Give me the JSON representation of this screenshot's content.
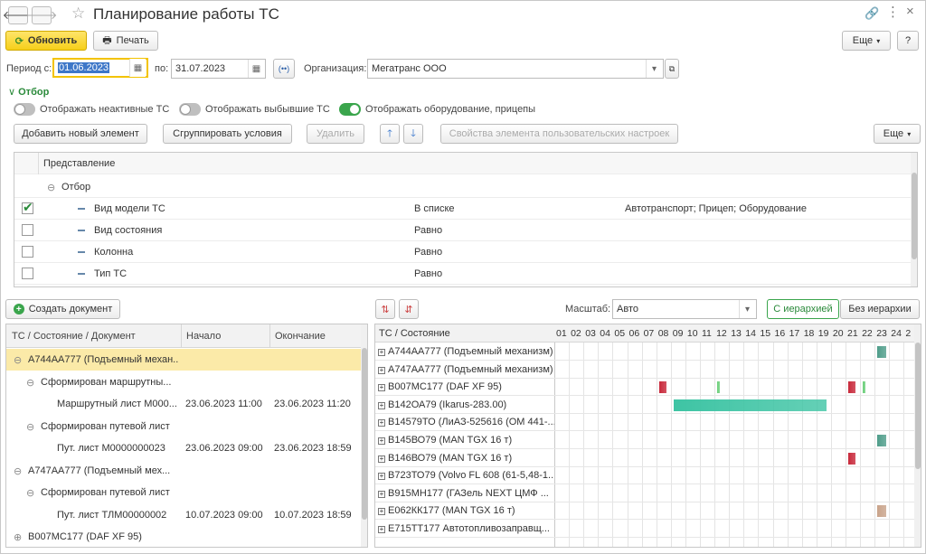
{
  "window": {
    "title": "Планирование работы ТС"
  },
  "toolbar": {
    "refresh": "Обновить",
    "print": "Печать",
    "more": "Еще",
    "help": "?"
  },
  "period": {
    "from_label": "Период с:",
    "from": "01.06.2023",
    "to_label": "по:",
    "to": "31.07.2023"
  },
  "org": {
    "label": "Организация:",
    "value": "Мегатранс ООО"
  },
  "filter": {
    "header": "Отбор",
    "toggles": [
      {
        "label": "Отображать неактивные ТС",
        "on": false
      },
      {
        "label": "Отображать выбывшие ТС",
        "on": false
      },
      {
        "label": "Отображать оборудование, прицепы",
        "on": true
      }
    ],
    "buttons": {
      "add": "Добавить новый элемент",
      "group": "Сгруппировать условия",
      "delete": "Удалить",
      "props": "Свойства элемента пользовательских настроек",
      "more": "Еще"
    },
    "table_header": "Представление",
    "root": "Отбор",
    "rows": [
      {
        "checked": true,
        "name": "Вид модели ТС",
        "cond": "В списке",
        "value": "Автотранспорт; Прицеп; Оборудование"
      },
      {
        "checked": false,
        "name": "Вид состояния",
        "cond": "Равно",
        "value": ""
      },
      {
        "checked": false,
        "name": "Колонна",
        "cond": "Равно",
        "value": ""
      },
      {
        "checked": false,
        "name": "Тип ТС",
        "cond": "Равно",
        "value": ""
      }
    ]
  },
  "left": {
    "create_doc": "Создать документ",
    "columns": [
      "ТС / Состояние / Документ",
      "Начало",
      "Окончание"
    ],
    "rows": [
      {
        "level": 0,
        "text": "А744АА777 (Подъемный механ...",
        "start": "",
        "end": "",
        "selected": true,
        "toggle": "⊖"
      },
      {
        "level": 1,
        "text": "Сформирован маршрутны...",
        "start": "",
        "end": "",
        "toggle": "⊖"
      },
      {
        "level": 2,
        "text": "Маршрутный лист М000...",
        "start": "23.06.2023 11:00",
        "end": "23.06.2023 11:20"
      },
      {
        "level": 1,
        "text": "Сформирован путевой лист",
        "start": "",
        "end": "",
        "toggle": "⊖"
      },
      {
        "level": 2,
        "text": "Пут. лист М0000000023",
        "start": "23.06.2023 09:00",
        "end": "23.06.2023 18:59"
      },
      {
        "level": 0,
        "text": "А747АА777 (Подъемный мех...",
        "start": "",
        "end": "",
        "toggle": "⊖"
      },
      {
        "level": 1,
        "text": "Сформирован путевой лист",
        "start": "",
        "end": "",
        "toggle": "⊖"
      },
      {
        "level": 2,
        "text": "Пут. лист ТЛМ00000002",
        "start": "10.07.2023 09:00",
        "end": "10.07.2023 18:59"
      },
      {
        "level": 0,
        "text": "В007МС177 (DAF XF 95)",
        "start": "",
        "end": "",
        "toggle": "⊕"
      }
    ]
  },
  "right": {
    "scale_label": "Масштаб:",
    "scale_value": "Авто",
    "with_hier": "С иерархией",
    "without_hier": "Без иерархии",
    "col_header": "ТС / Состояние",
    "days": [
      "01",
      "02",
      "03",
      "04",
      "05",
      "06",
      "07",
      "08",
      "09",
      "10",
      "11",
      "12",
      "13",
      "14",
      "15",
      "16",
      "17",
      "18",
      "19",
      "20",
      "21",
      "22",
      "23",
      "24",
      "2"
    ],
    "rows": [
      {
        "name": "А744АА777 (Подъемный механизм)",
        "bars": [
          {
            "day": 23,
            "len": 0.6,
            "color": "#4f9d8a"
          }
        ]
      },
      {
        "name": "А747АА777 (Подъемный механизм)",
        "bars": []
      },
      {
        "name": "В007МС177 (DAF XF 95)",
        "bars": [
          {
            "day": 8,
            "len": 0.5,
            "color": "#c8283a"
          },
          {
            "day": 12,
            "len": 0.15,
            "color": "#6bcf7a"
          },
          {
            "day": 21,
            "len": 0.5,
            "color": "#c8283a"
          },
          {
            "day": 22,
            "len": 0.15,
            "color": "#6bcf7a"
          }
        ]
      },
      {
        "name": "В142ОА79 (Ikarus-283.00)",
        "bars": [
          {
            "day": 9,
            "len": 10.5,
            "color": "#3ec4a4"
          }
        ]
      },
      {
        "name": "В14579ТО (ЛиАЗ-525616 (ОМ 441-...",
        "bars": []
      },
      {
        "name": "В145ВО79 (MAN TGX 16 т)",
        "bars": [
          {
            "day": 23,
            "len": 0.6,
            "color": "#4f9d8a"
          }
        ]
      },
      {
        "name": "В146ВО79 (MAN TGX 16 т)",
        "bars": [
          {
            "day": 21,
            "len": 0.5,
            "color": "#c8283a"
          }
        ]
      },
      {
        "name": "В723ТО79 (Volvo FL 608 (61-5,48-1...",
        "bars": []
      },
      {
        "name": "В915МН177 (ГАЗель NEXT ЦМФ ...",
        "bars": []
      },
      {
        "name": "Е062КК177 (MAN TGX 16 т)",
        "bars": [
          {
            "day": 23,
            "len": 0.6,
            "color": "#c9a38a"
          }
        ]
      },
      {
        "name": "Е715ТТ177 Автотопливозаправщ...",
        "bars": []
      }
    ]
  }
}
